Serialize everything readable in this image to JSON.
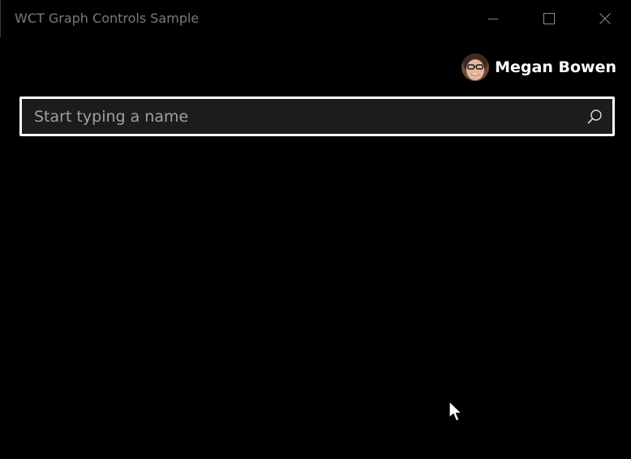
{
  "window": {
    "title": "WCT Graph Controls Sample"
  },
  "caption_buttons": {
    "minimize_icon": "minimize-icon",
    "maximize_icon": "maximize-icon",
    "close_icon": "close-icon"
  },
  "user": {
    "name": "Megan Bowen",
    "avatar_icon": "avatar"
  },
  "search": {
    "placeholder": "Start typing a name",
    "value": "",
    "icon": "search-icon"
  },
  "colors": {
    "background": "#000000",
    "title_text": "#7a7a7a",
    "search_border": "#ffffff",
    "search_fill": "#1c1c1c",
    "placeholder": "#a0a0a0"
  }
}
